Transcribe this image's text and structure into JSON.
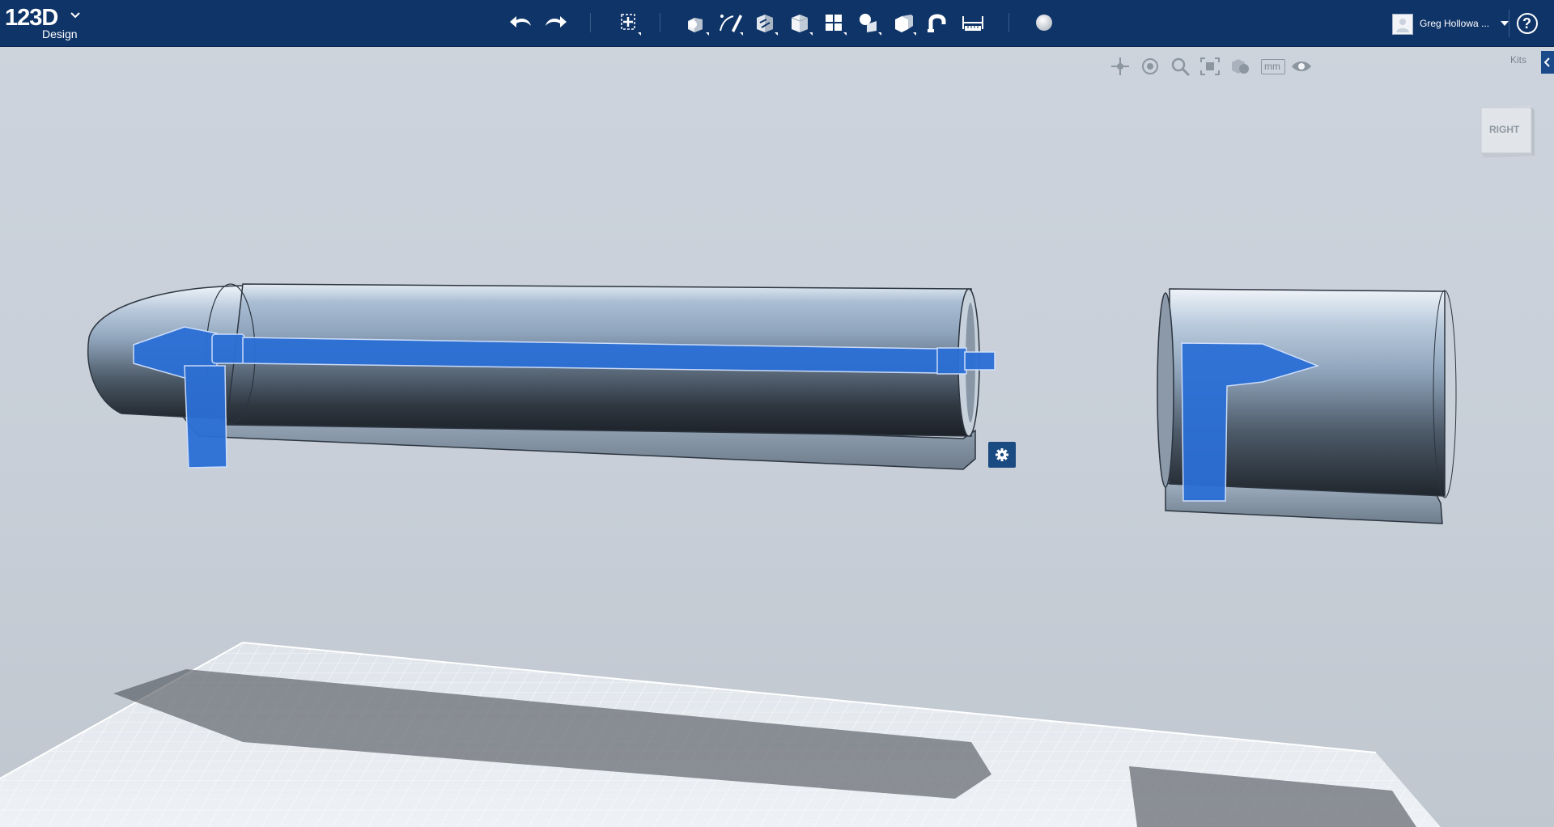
{
  "app": {
    "logo_text": "123D",
    "logo_sub": "Design"
  },
  "toolbar": {
    "icons": [
      "undo-icon",
      "redo-icon",
      "transform-icon",
      "primitives-icon",
      "sketch-icon",
      "construct-icon",
      "modify-icon",
      "pattern-icon",
      "grouping-icon",
      "combine-icon",
      "snap-icon",
      "measure-icon",
      "material-icon"
    ]
  },
  "user": {
    "name": "Greg Hollowa ..."
  },
  "help": {
    "label": "?"
  },
  "nav": {
    "units_label": "mm"
  },
  "kits": {
    "label": "Kits"
  },
  "viewcube": {
    "face_label": "RIGHT"
  },
  "colors": {
    "topbar": "#0f3468",
    "selection": "#2b6fd6",
    "accent": "#1a4a82"
  }
}
